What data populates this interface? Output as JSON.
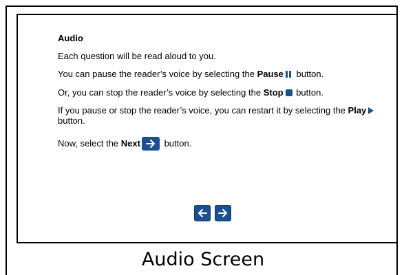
{
  "screen": {
    "heading": "Audio",
    "line1": "Each question will be read aloud to you.",
    "line2_pre": "You can pause the reader’s voice by selecting the ",
    "line2_bold": "Pause",
    "line2_post": " button.",
    "line3_pre": "Or, you can stop the reader’s voice by selecting the ",
    "line3_bold": "Stop",
    "line3_post": " button.",
    "line4_pre": "If you pause or stop the reader’s voice, you can restart it by selecting the ",
    "line4_bold": "Play",
    "line4_post": " button.",
    "line5_pre": "Now, select the ",
    "line5_bold": "Next",
    "line5_post": " button."
  },
  "nav": {
    "back_icon": "arrow-left-icon",
    "next_icon": "arrow-right-icon"
  },
  "caption": "Audio Screen",
  "colors": {
    "button_blue": "#1b4f8f",
    "border": "#000000"
  }
}
